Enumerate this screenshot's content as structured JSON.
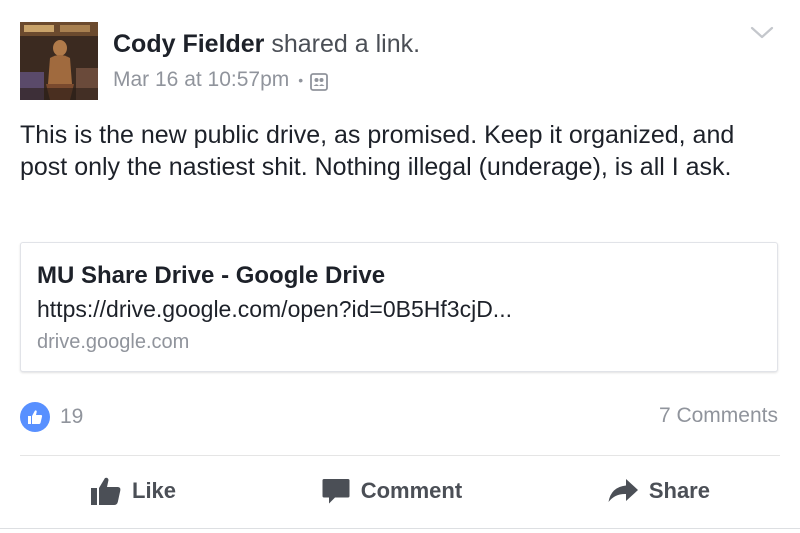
{
  "post": {
    "author": "Cody Fielder",
    "action_text": "shared a link.",
    "timestamp": "Mar 16 at 10:57pm",
    "meta_separator": "•",
    "audience_icon": "friends-icon",
    "message": "This is the new public drive, as promised. Keep it organized, and post only the nastiest shit. Nothing illegal (underage), is all I ask."
  },
  "link_card": {
    "title": "MU Share Drive - Google Drive",
    "url": "https://drive.google.com/open?id=0B5Hf3cjD...",
    "domain": "drive.google.com"
  },
  "reactions": {
    "icon": "thumbs-up-icon",
    "count": "19",
    "comments": "7 Comments"
  },
  "actions": {
    "like": "Like",
    "comment": "Comment",
    "share": "Share"
  },
  "colors": {
    "like_blue": "#5890ff",
    "text_primary": "#1d2129",
    "text_secondary": "#90949c",
    "action_gray": "#4b4f56"
  }
}
